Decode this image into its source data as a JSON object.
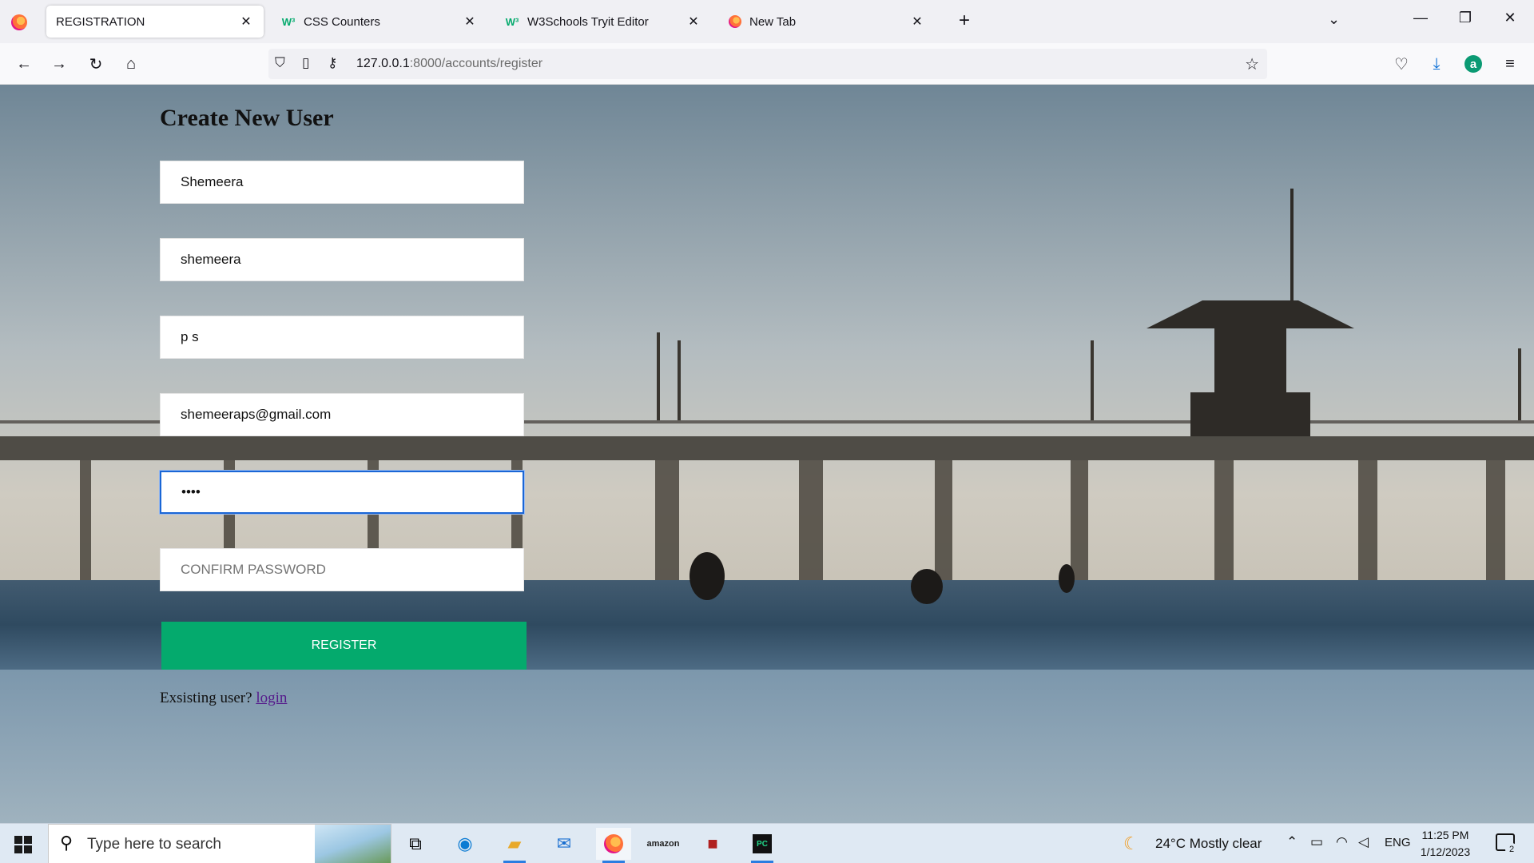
{
  "browser": {
    "tabs": [
      {
        "label": "REGISTRATION",
        "icon": "firefox-page-icon",
        "active": true
      },
      {
        "label": "CSS Counters",
        "icon": "w3schools-icon",
        "active": false
      },
      {
        "label": "W3Schools Tryit Editor",
        "icon": "w3schools-icon",
        "active": false
      },
      {
        "label": "New Tab",
        "icon": "firefox-icon",
        "active": false
      }
    ],
    "url_host": "127.0.0.1",
    "url_rest": ":8000/accounts/register",
    "profile_initial": "a"
  },
  "form": {
    "title": "Create New User",
    "fields": [
      {
        "name": "first-name",
        "value": "Shemeera",
        "placeholder": ""
      },
      {
        "name": "username",
        "value": "shemeera",
        "placeholder": ""
      },
      {
        "name": "last-name",
        "value": "p s",
        "placeholder": ""
      },
      {
        "name": "email",
        "value": "shemeeraps@gmail.com",
        "placeholder": ""
      },
      {
        "name": "password",
        "value": "abcd",
        "placeholder": ""
      },
      {
        "name": "confirm-password",
        "value": "",
        "placeholder": "CONFIRM PASSWORD"
      }
    ],
    "register_label": "REGISTER",
    "existing_text": "Exsisting user?",
    "login_link": "login"
  },
  "taskbar": {
    "search_placeholder": "Type here to search",
    "weather": "24°C  Mostly clear",
    "language": "ENG",
    "time": "11:25 PM",
    "date": "1/12/2023",
    "notification_count": "2"
  },
  "colors": {
    "accent_green": "#04aa6d",
    "focus_blue": "#1a66d6",
    "link_visited": "#551a8b"
  }
}
